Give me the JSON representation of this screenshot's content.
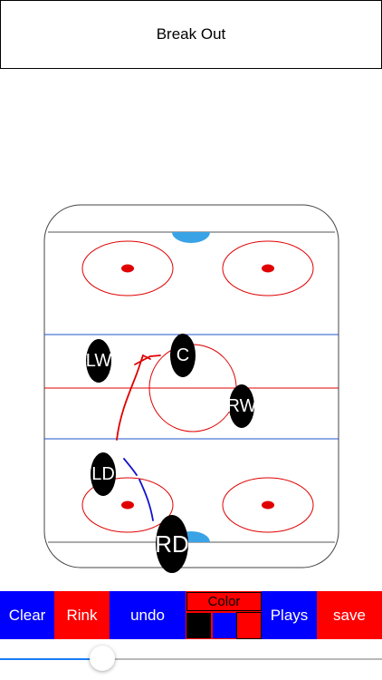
{
  "title": "Break Out",
  "players": [
    {
      "key": "lw",
      "label": "LW"
    },
    {
      "key": "c",
      "label": "C"
    },
    {
      "key": "rw",
      "label": "RW"
    },
    {
      "key": "ld",
      "label": "LD"
    },
    {
      "key": "rd",
      "label": "RD"
    }
  ],
  "toolbar": {
    "clear": "Clear",
    "rink": "Rink",
    "undo": "undo",
    "color": "Color",
    "plays": "Plays",
    "save": "save"
  },
  "colors": {
    "toolbar_blue": "#0000ff",
    "toolbar_red": "#ff0000",
    "swatch_black": "#000000",
    "swatch_blue": "#0000ff",
    "swatch_red": "#ff0000",
    "rink_red": "#e00000",
    "rink_blue": "#2255cc",
    "goal_crease": "#3aa3e6",
    "slider_fill": "#1a7cf5"
  },
  "slider": {
    "value": 0.25
  }
}
